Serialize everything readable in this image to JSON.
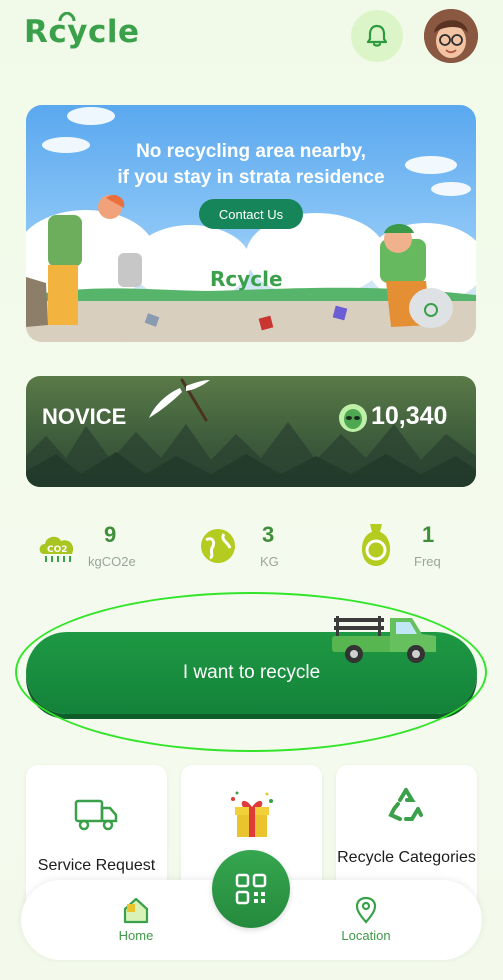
{
  "header": {
    "logo_text": "Rcycle",
    "notification_icon": "bell-icon",
    "avatar": "user-avatar"
  },
  "banner": {
    "title_line1": "No recycling area nearby,",
    "title_line2": "if you stay in strata residence",
    "button_label": "Contact Us",
    "logo_text": "Rcycle"
  },
  "level": {
    "name": "NOVICE",
    "points": "10,340"
  },
  "stats": [
    {
      "value": "9",
      "unit": "kgCO2e",
      "icon": "co2-cloud-icon"
    },
    {
      "value": "3",
      "unit": "KG",
      "icon": "globe-icon"
    },
    {
      "value": "1",
      "unit": "Freq",
      "icon": "recycle-bag-icon"
    }
  ],
  "main_action": {
    "label": "I want to recycle"
  },
  "cards": [
    {
      "label": "Service Request",
      "icon": "truck-icon"
    },
    {
      "label": "",
      "icon": "gift-icon"
    },
    {
      "label": "Recycle Categories",
      "icon": "recycle-icon"
    }
  ],
  "nav": {
    "home_label": "Home",
    "location_label": "Location",
    "center_icon": "qr-code-icon"
  },
  "colors": {
    "brand": "#3aa04a",
    "button": "#13823a",
    "highlight": "#33e52a"
  }
}
